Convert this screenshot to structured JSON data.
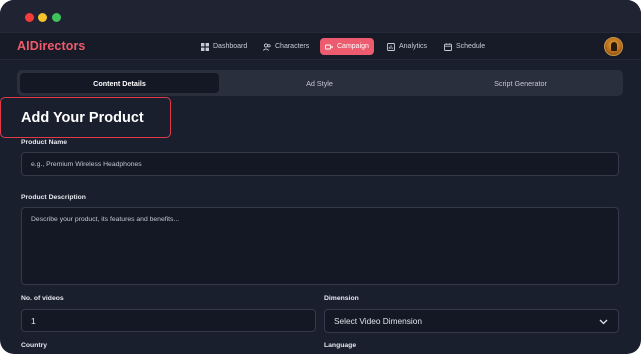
{
  "nav": {
    "brand": "AIDirectors",
    "items": [
      {
        "label": "Dashboard",
        "icon": "grid-icon"
      },
      {
        "label": "Characters",
        "icon": "users-icon"
      },
      {
        "label": "Campaign",
        "icon": "video-icon",
        "active": true
      },
      {
        "label": "Analytics",
        "icon": "chart-icon"
      },
      {
        "label": "Schedule",
        "icon": "calendar-icon"
      }
    ]
  },
  "tabs": [
    {
      "label": "Content Details",
      "active": true
    },
    {
      "label": "Ad Style"
    },
    {
      "label": "Script Generator"
    }
  ],
  "form": {
    "heading": "Add Your Product",
    "product_name_label": "Product Name",
    "product_name_placeholder": "e.g., Premium Wireless Headphones",
    "product_description_label": "Product Description",
    "product_description_placeholder": "Describe your product, its features and benefits...",
    "videos_label": "No. of videos",
    "videos_value": "1",
    "dimension_label": "Dimension",
    "dimension_value": "Select Video Dimension",
    "country_label": "Country",
    "language_label": "Language"
  },
  "colors": {
    "accent": "#ec5b6e",
    "background": "#1a1f2e",
    "field_bg": "#141824"
  }
}
